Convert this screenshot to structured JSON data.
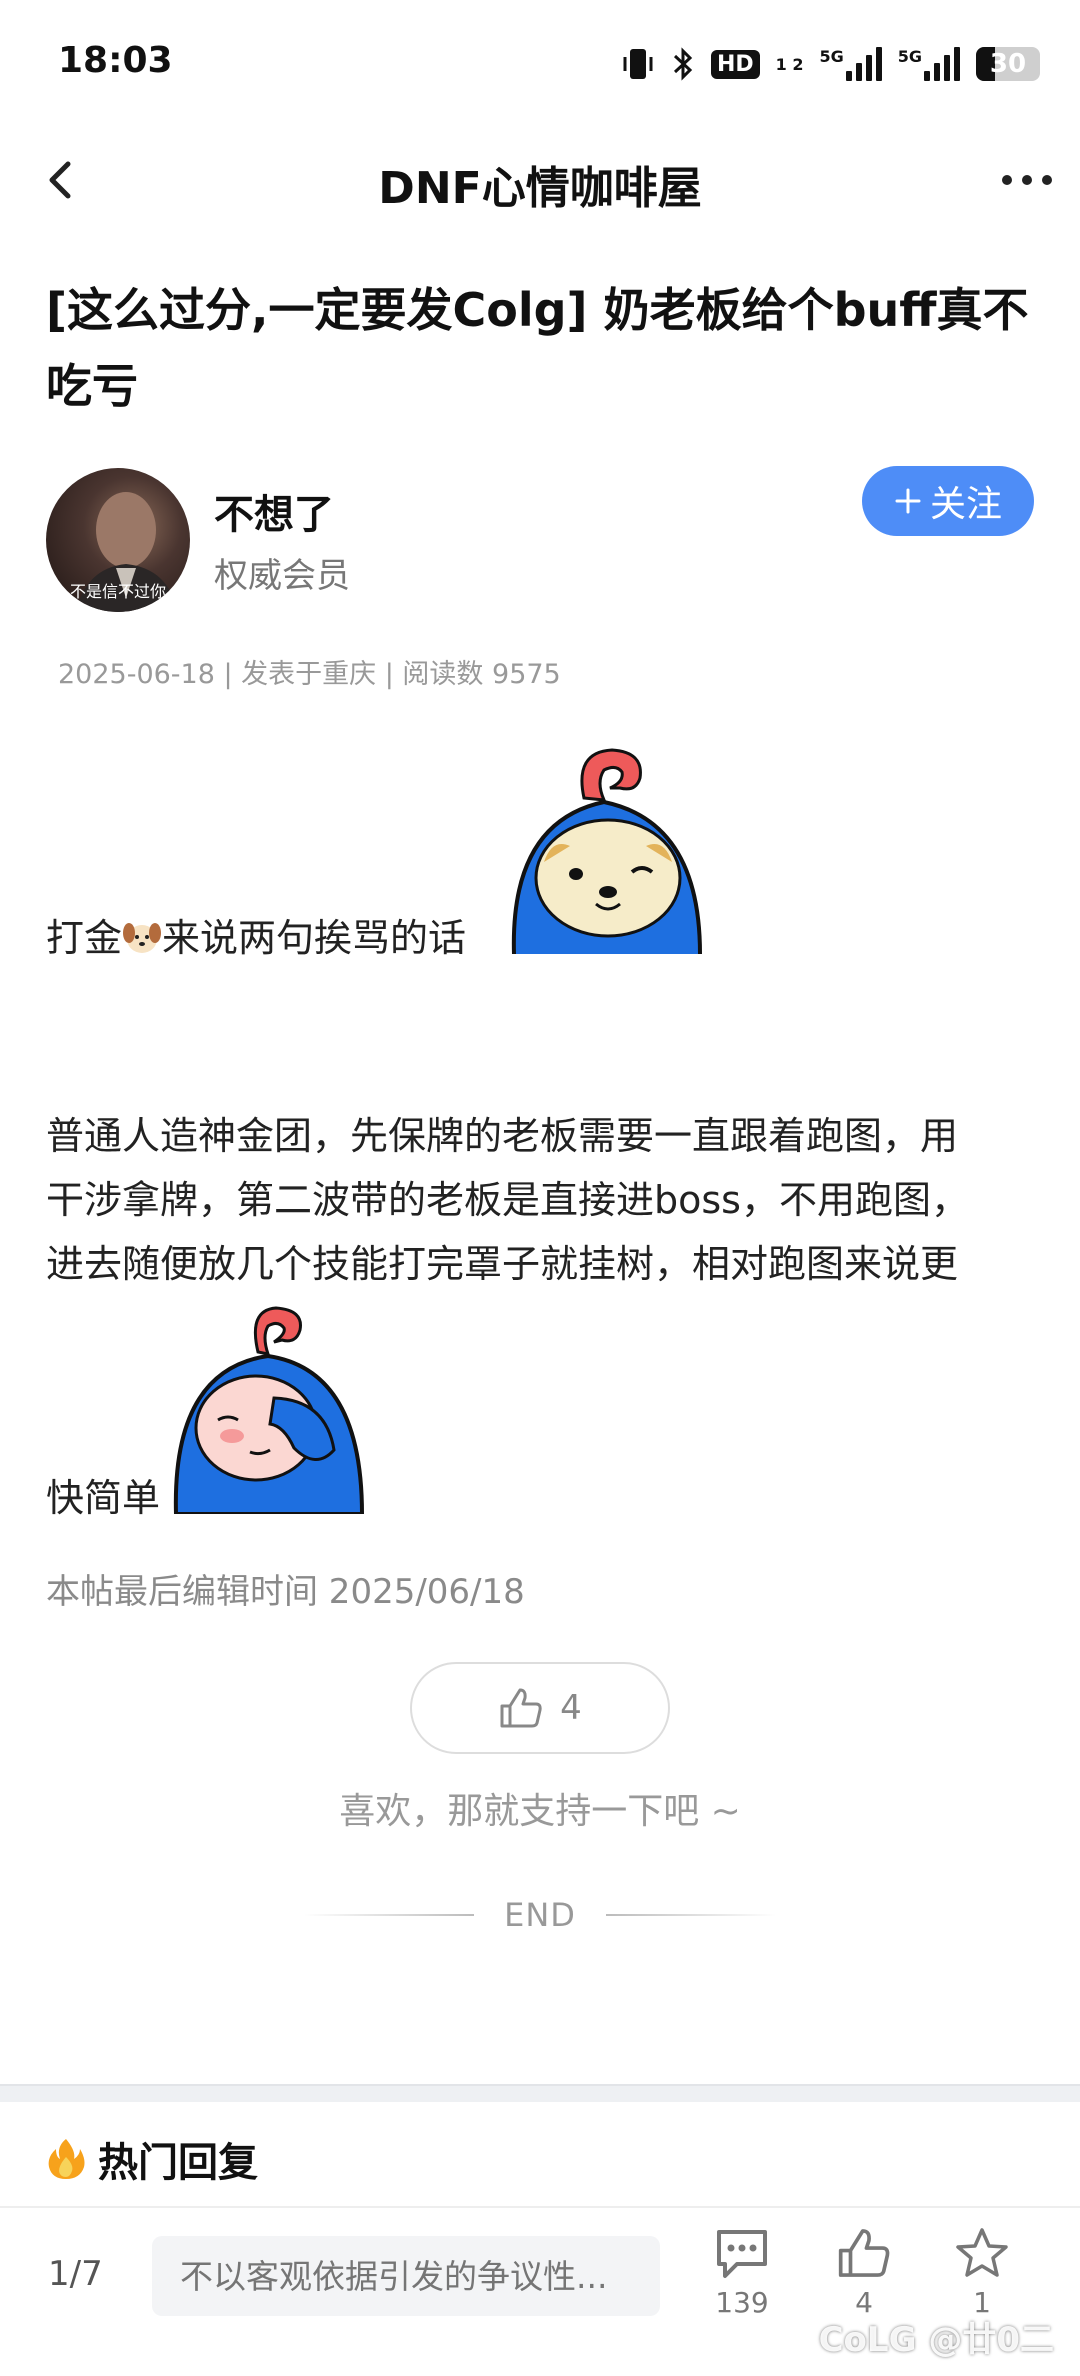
{
  "status_bar": {
    "time": "18:03",
    "hd_badge": "HD",
    "hd_sub": "1 2",
    "signal1_label": "5G",
    "signal2_label": "5G",
    "battery": "30",
    "battery_level": 0.3
  },
  "nav": {
    "title": "DNF心情咖啡屋"
  },
  "post": {
    "title": "[这么过分,一定要发Colg] 奶老板给个buff真不吃亏",
    "author": {
      "name": "不想了",
      "role": "权威会员",
      "avatar_caption": "不是信不过你"
    },
    "follow_label": "关注",
    "meta": "2025-06-18 | 发表于重庆 | 阅读数 9575",
    "content": {
      "line1_pre": "打金",
      "line1_post": "来说两句挨骂的话",
      "paragraph2_lines": [
        "普通人造神金团，先保牌的老板需要一直跟着跑图，用",
        "干涉拿牌，第二波带的老板是直接进boss，不用跑图，",
        "进去随便放几个技能打完罩子就挂树，相对跑图来说更"
      ],
      "paragraph2_tail": "快简单"
    },
    "edit_time": "本帖最后编辑时间 2025/06/18",
    "like_count": "4",
    "like_hint": "喜欢，那就支持一下吧 ~",
    "end_label": "END"
  },
  "hot_replies": {
    "title": "热门回复"
  },
  "bottom_bar": {
    "page_indicator": "1/7",
    "input_placeholder": "不以客观依据引发的争议性...",
    "comments_count": "139",
    "likes_count": "4",
    "favorites_count": "1"
  },
  "watermark": "CoLG @廿0二",
  "colors": {
    "accent": "#4e8df7",
    "sticker_blue": "#1e6fe0",
    "sticker_red": "#ee5a5a"
  }
}
